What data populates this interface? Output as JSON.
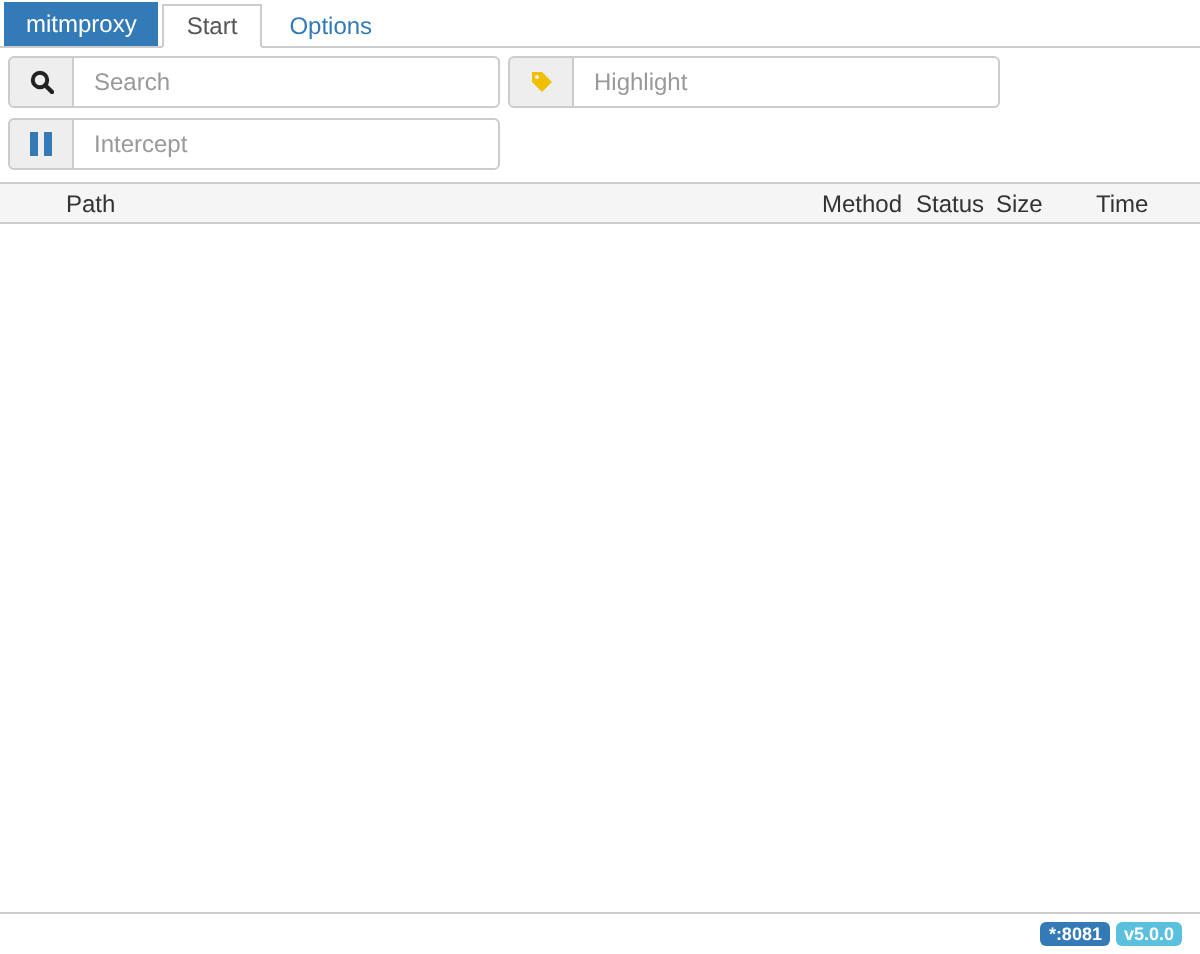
{
  "brand": "mitmproxy",
  "tabs": [
    {
      "label": "Start",
      "selected": true
    },
    {
      "label": "Options",
      "selected": false
    }
  ],
  "filters": [
    {
      "kind": "search",
      "placeholder": "Search"
    },
    {
      "kind": "highlight",
      "placeholder": "Highlight"
    },
    {
      "kind": "intercept",
      "placeholder": "Intercept"
    }
  ],
  "table": {
    "columns": [
      "Path",
      "Method",
      "Status",
      "Size",
      "Time"
    ]
  },
  "status_bar": {
    "badges": [
      {
        "label": "*:8081",
        "color": "#337ab7"
      },
      {
        "label": "v5.0.0",
        "color": "#5bc0de"
      }
    ]
  }
}
